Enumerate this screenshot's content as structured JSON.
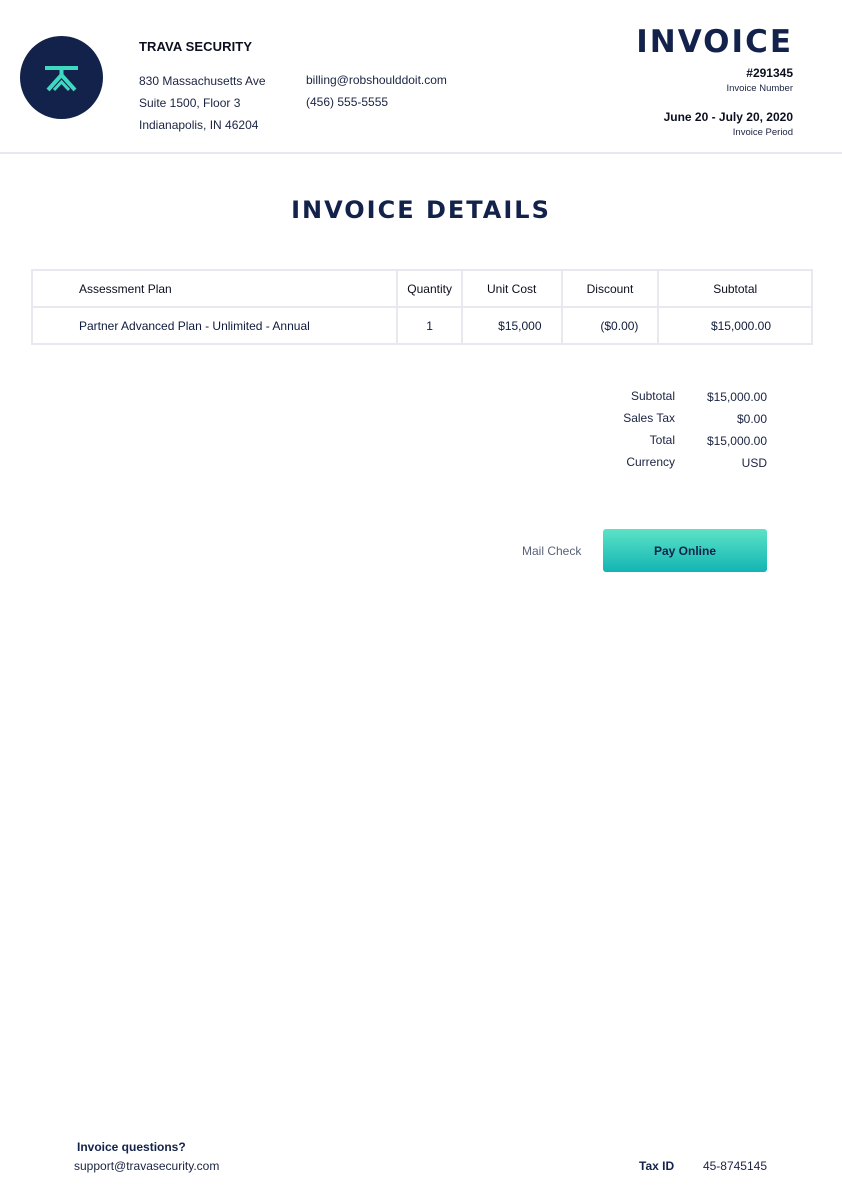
{
  "company": {
    "name": "TRAVA SECURITY",
    "address": [
      "830 Massachusetts Ave",
      "Suite 1500, Floor 3",
      "Indianapolis, IN 46204"
    ],
    "email": "billing@robshoulddoit.com",
    "phone": "(456) 555-5555"
  },
  "invoice": {
    "title": "INVOICE",
    "number": "#291345",
    "number_label": "Invoice Number",
    "period": "June 20 - July 20, 2020",
    "period_label": "Invoice Period"
  },
  "details": {
    "title": "INVOICE DETAILS",
    "headers": {
      "plan": "Assessment Plan",
      "quantity": "Quantity",
      "unit_cost": "Unit Cost",
      "discount": "Discount",
      "subtotal": "Subtotal"
    },
    "rows": [
      {
        "plan": "Partner Advanced Plan - Unlimited - Annual",
        "quantity": "1",
        "unit_cost": "$15,000",
        "discount": "($0.00)",
        "subtotal": "$15,000.00"
      }
    ]
  },
  "totals": [
    {
      "label": "Subtotal",
      "value": "$15,000.00"
    },
    {
      "label": "Sales Tax",
      "value": "$0.00"
    },
    {
      "label": "Total",
      "value": "$15,000.00"
    },
    {
      "label": "Currency",
      "value": "USD"
    }
  ],
  "actions": {
    "mail_check": "Mail Check",
    "pay_online": "Pay Online"
  },
  "footer": {
    "question": "Invoice questions?",
    "support_email": "support@travasecurity.com",
    "tax_id_label": "Tax ID",
    "tax_id_value": "45-8745145"
  },
  "colors": {
    "navy": "#13224a",
    "teal_top": "#5de3c6",
    "teal_bottom": "#12b4b4",
    "logo_mark": "#3fd8c0"
  },
  "icons": {
    "logo": "trava-logo-icon"
  }
}
